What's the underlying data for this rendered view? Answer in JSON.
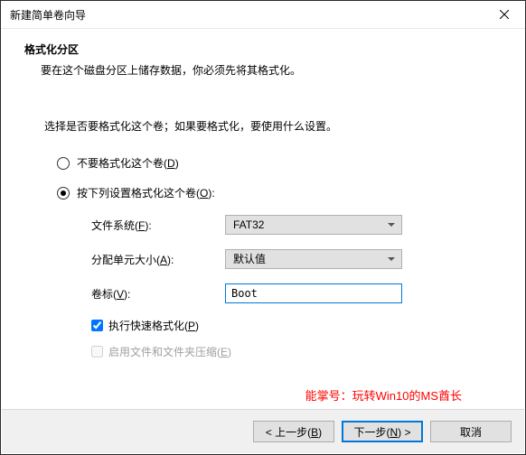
{
  "window": {
    "title": "新建简单卷向导"
  },
  "header": {
    "title": "格式化分区",
    "desc": "要在这个磁盘分区上储存数据，你必须先将其格式化。"
  },
  "main": {
    "prompt": "选择是否要格式化这个卷；如果要格式化，要使用什么设置。",
    "opt_no_format": "不要格式化这个卷",
    "opt_no_format_accel": "D",
    "opt_format": "按下列设置格式化这个卷",
    "opt_format_accel": "O",
    "fs_label": "文件系统",
    "fs_accel": "F",
    "fs_value": "FAT32",
    "au_label": "分配单元大小",
    "au_accel": "A",
    "au_value": "默认值",
    "vol_label": "卷标",
    "vol_accel": "V",
    "vol_value": "Boot",
    "quick_label": "执行快速格式化",
    "quick_accel": "P",
    "compress_label": "启用文件和文件夹压缩",
    "compress_accel": "E"
  },
  "footer": {
    "back": "< 上一步",
    "back_accel": "B",
    "next": "下一步",
    "next_accel": "N",
    "next_suffix": " >",
    "cancel": "取消"
  },
  "watermark": "能掌号：玩转Win10的MS酋长"
}
